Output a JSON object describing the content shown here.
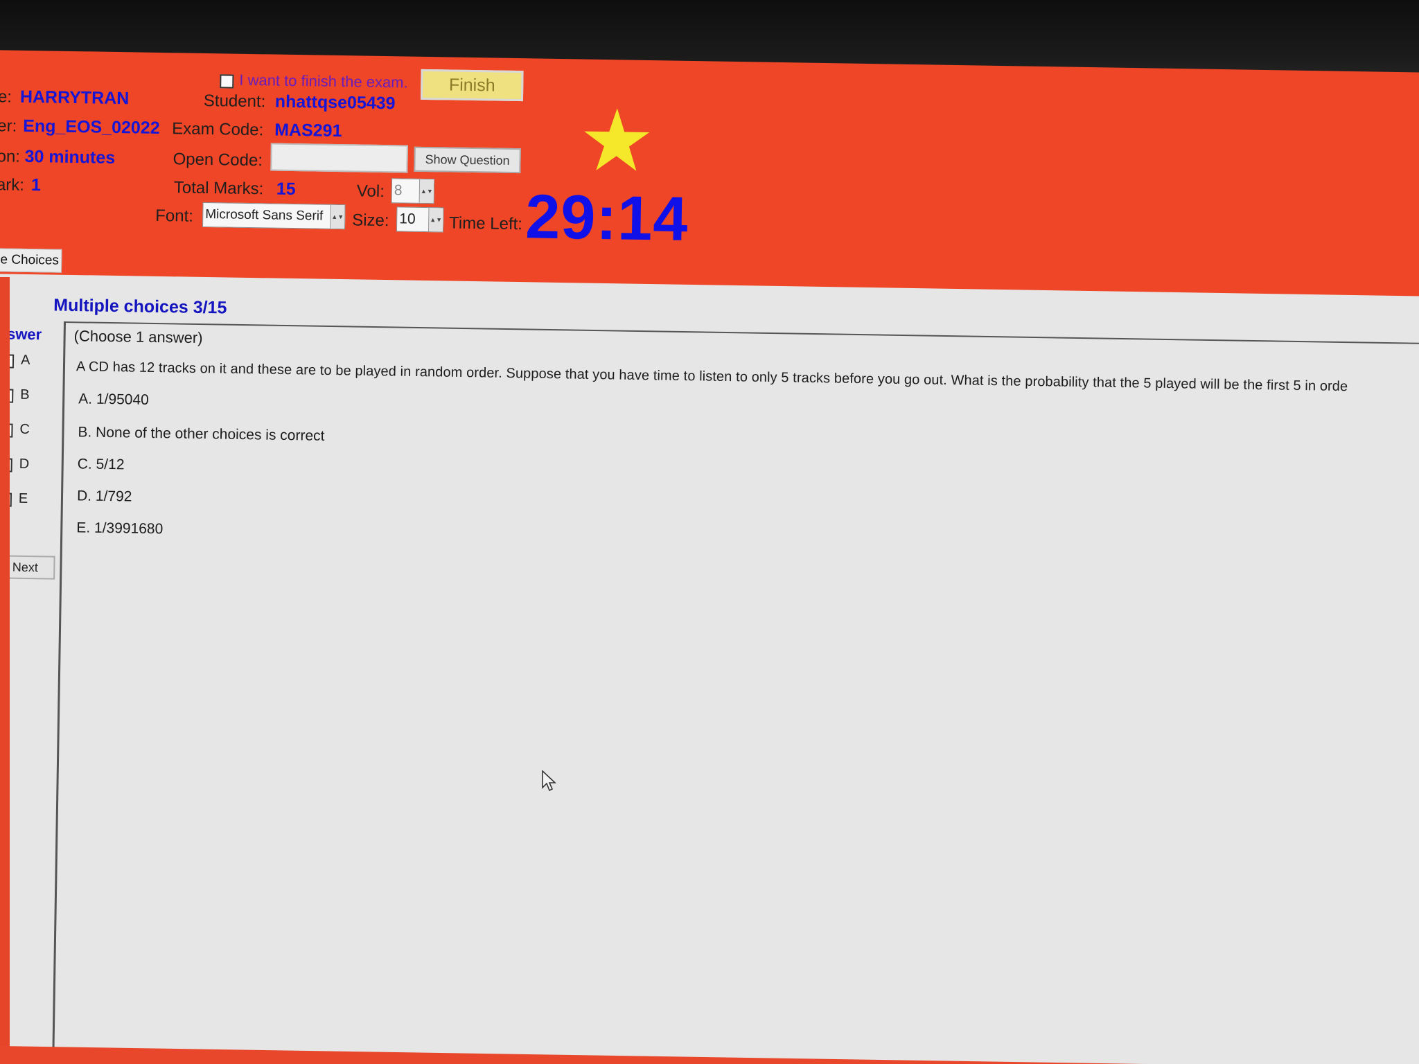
{
  "header": {
    "finish_checkbox_label": "I want to finish the exam.",
    "finish_button": "Finish",
    "name_label": "e:",
    "name_value": "HARRYTRAN",
    "student_label": "Student:",
    "student_value": "nhattqse05439",
    "server_label": "er:",
    "server_value": "Eng_EOS_02022",
    "exam_code_label": "Exam Code:",
    "exam_code_value": "MAS291",
    "duration_label": "on:",
    "duration_value": "30 minutes",
    "open_code_label": "Open Code:",
    "open_code_value": "",
    "show_question_button": "Show Question",
    "mark_label": "ark:",
    "mark_value": "1",
    "total_marks_label": "Total Marks:",
    "total_marks_value": "15",
    "vol_label": "Vol:",
    "vol_value": "8",
    "font_label": "Font:",
    "font_value": "Microsoft Sans Serif",
    "size_label": "Size:",
    "size_value": "10",
    "time_left_label": "Time Left:",
    "time_left_value": "29:14",
    "star_color": "#f5e82a"
  },
  "tab": {
    "label": "le Choices"
  },
  "question": {
    "section_title": "Multiple choices 3/15",
    "answer_header": "nswer",
    "instruction": "(Choose 1 answer)",
    "text": "A CD has 12 tracks on it and these are to be played in random order. Suppose that you have time to listen to only 5 tracks before you go out. What is the probability that the 5 played will be the first 5 in orde",
    "choices": [
      {
        "letter": "A",
        "label": "A.  1/95040"
      },
      {
        "letter": "B",
        "label": "B.  None of the other choices is correct"
      },
      {
        "letter": "C",
        "label": "C.  5/12"
      },
      {
        "letter": "D",
        "label": "D.  1/792"
      },
      {
        "letter": "E",
        "label": "E.  1/3991680"
      }
    ],
    "next_button": "Next"
  },
  "colors": {
    "header_bg": "#ee4626",
    "content_bg": "#e6e6e6",
    "value_blue": "#1515d8",
    "timer_blue": "#1010e8"
  }
}
